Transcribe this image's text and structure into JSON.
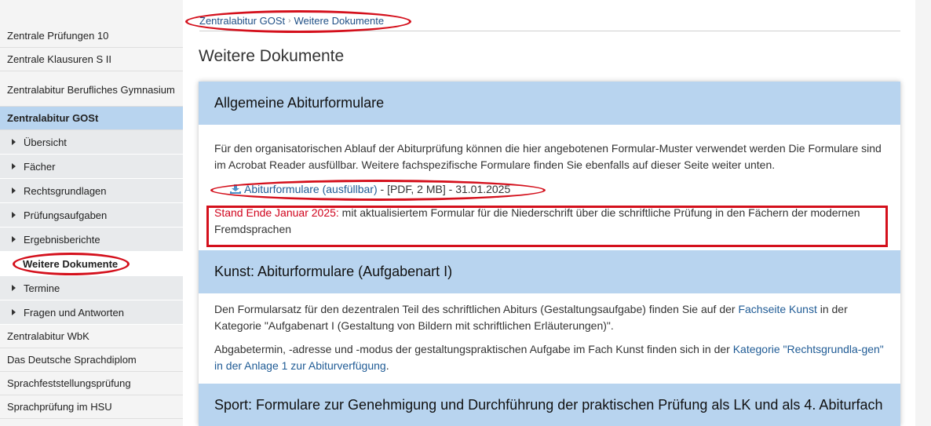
{
  "sidebar": {
    "items": [
      {
        "label": "Zentrale Prüfungen 10"
      },
      {
        "label": "Zentrale Klausuren S II"
      },
      {
        "label": "Zentralabitur Berufliches Gymnasium"
      },
      {
        "label": "Zentralabitur GOSt"
      }
    ],
    "subitems": [
      {
        "label": "Übersicht"
      },
      {
        "label": "Fächer"
      },
      {
        "label": "Rechtsgrundlagen"
      },
      {
        "label": "Prüfungsaufgaben"
      },
      {
        "label": "Ergebnisberichte"
      },
      {
        "label": "Weitere Dokumente"
      },
      {
        "label": "Termine"
      },
      {
        "label": "Fragen und Antworten"
      }
    ],
    "bottom_items": [
      {
        "label": "Zentralabitur WbK"
      },
      {
        "label": "Das Deutsche Sprachdiplom"
      },
      {
        "label": "Sprachfeststellungsprüfung"
      },
      {
        "label": "Sprachprüfung im HSU"
      }
    ]
  },
  "breadcrumb": {
    "items": [
      {
        "label": "Zentralabitur GOSt"
      },
      {
        "label": "Weitere Dokumente"
      }
    ],
    "separator": "›"
  },
  "page": {
    "title": "Weitere Dokumente"
  },
  "sections": [
    {
      "title": "Allgemeine Abiturformulare",
      "text": "Für den organisatorischen Ablauf der Abiturprüfung können die hier angebotenen Formular-Muster verwendet werden Die Formulare sind im Acrobat Reader ausfüllbar. Weitere fachspezifische Formulare finden Sie ebenfalls auf dieser Seite weiter unten.",
      "download": {
        "label": "Abiturformulare (ausfüllbar)",
        "meta": " - [PDF, 2 MB] - 31.01.2025"
      },
      "notice": {
        "highlight": "Stand Ende Januar 2025:",
        "text": " mit aktualisiertem Formular für die Niederschrift über die schriftliche Prüfung in den Fächern der modernen Fremdsprachen"
      }
    },
    {
      "title": "Kunst: Abiturformulare (Aufgabenart I)",
      "p1_before": "Den Formularsatz für den dezentralen Teil des schriftlichen Abiturs (Gestaltungsaufgabe) finden Sie auf der ",
      "p1_link": "Fachseite Kunst",
      "p1_after": " in der Kategorie \"Aufgabenart I (Gestaltung von Bildern mit schriftlichen Erläuterungen)\".",
      "p2_before": "Abgabetermin, -adresse und -modus der gestaltungspraktischen Aufgabe im Fach Kunst finden sich in der ",
      "p2_link": "Kategorie \"Rechtsgrundla-gen\" in der Anlage 1 zur Abiturverfügung",
      "p2_after": "."
    },
    {
      "title": "Sport: Formulare zur Genehmigung und Durchführung der praktischen Prüfung als LK und als 4. Abiturfach"
    }
  ],
  "colors": {
    "accent": "#b8d4ef",
    "link": "#1f5b95",
    "annotation": "#d4101c",
    "notice": "#d0021b"
  }
}
